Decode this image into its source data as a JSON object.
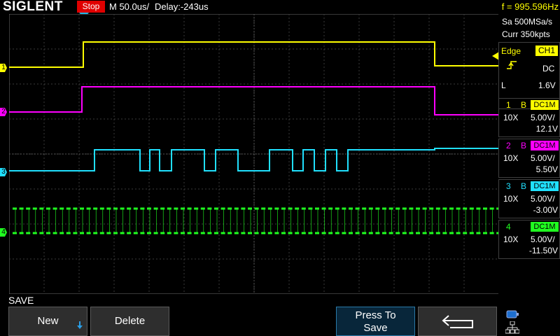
{
  "header": {
    "brand": "SIGLENT",
    "run_state": "Stop",
    "timebase": "M 50.0us/",
    "delay": "Delay:-243us",
    "frequency": "f = 995.596Hz"
  },
  "acquisition": {
    "sample_rate": "Sa 500MSa/s",
    "memory_depth": "Curr 350kpts"
  },
  "trigger": {
    "type_label": "Edge",
    "source": "CH1",
    "coupling": "DC",
    "level_prefix": "L",
    "level": "1.6V"
  },
  "channels": [
    {
      "num": "1",
      "bw": "B",
      "coupling": "DC1M",
      "probe": "10X",
      "scale": "5.00V/",
      "offset": "12.1V",
      "color": "#ffff00"
    },
    {
      "num": "2",
      "bw": "B",
      "coupling": "DC1M",
      "probe": "10X",
      "scale": "5.00V/",
      "offset": "5.50V",
      "color": "#ff00ff"
    },
    {
      "num": "3",
      "bw": "B",
      "coupling": "DC1M",
      "probe": "10X",
      "scale": "5.00V/",
      "offset": "-3.00V",
      "color": "#20e0ff"
    },
    {
      "num": "4",
      "bw": "",
      "coupling": "DC1M",
      "probe": "10X",
      "scale": "5.00V/",
      "offset": "-11.50V",
      "color": "#20ff20"
    }
  ],
  "trace_markers": [
    "1",
    "2",
    "3",
    "4"
  ],
  "menu": {
    "title": "SAVE",
    "buttons": [
      "New",
      "Delete",
      "Press To",
      "Save"
    ]
  },
  "icons": {
    "new_arrow": "down-arrow-icon",
    "return": "return-arrow-icon",
    "usb": "usb-icon",
    "network": "network-icon"
  }
}
